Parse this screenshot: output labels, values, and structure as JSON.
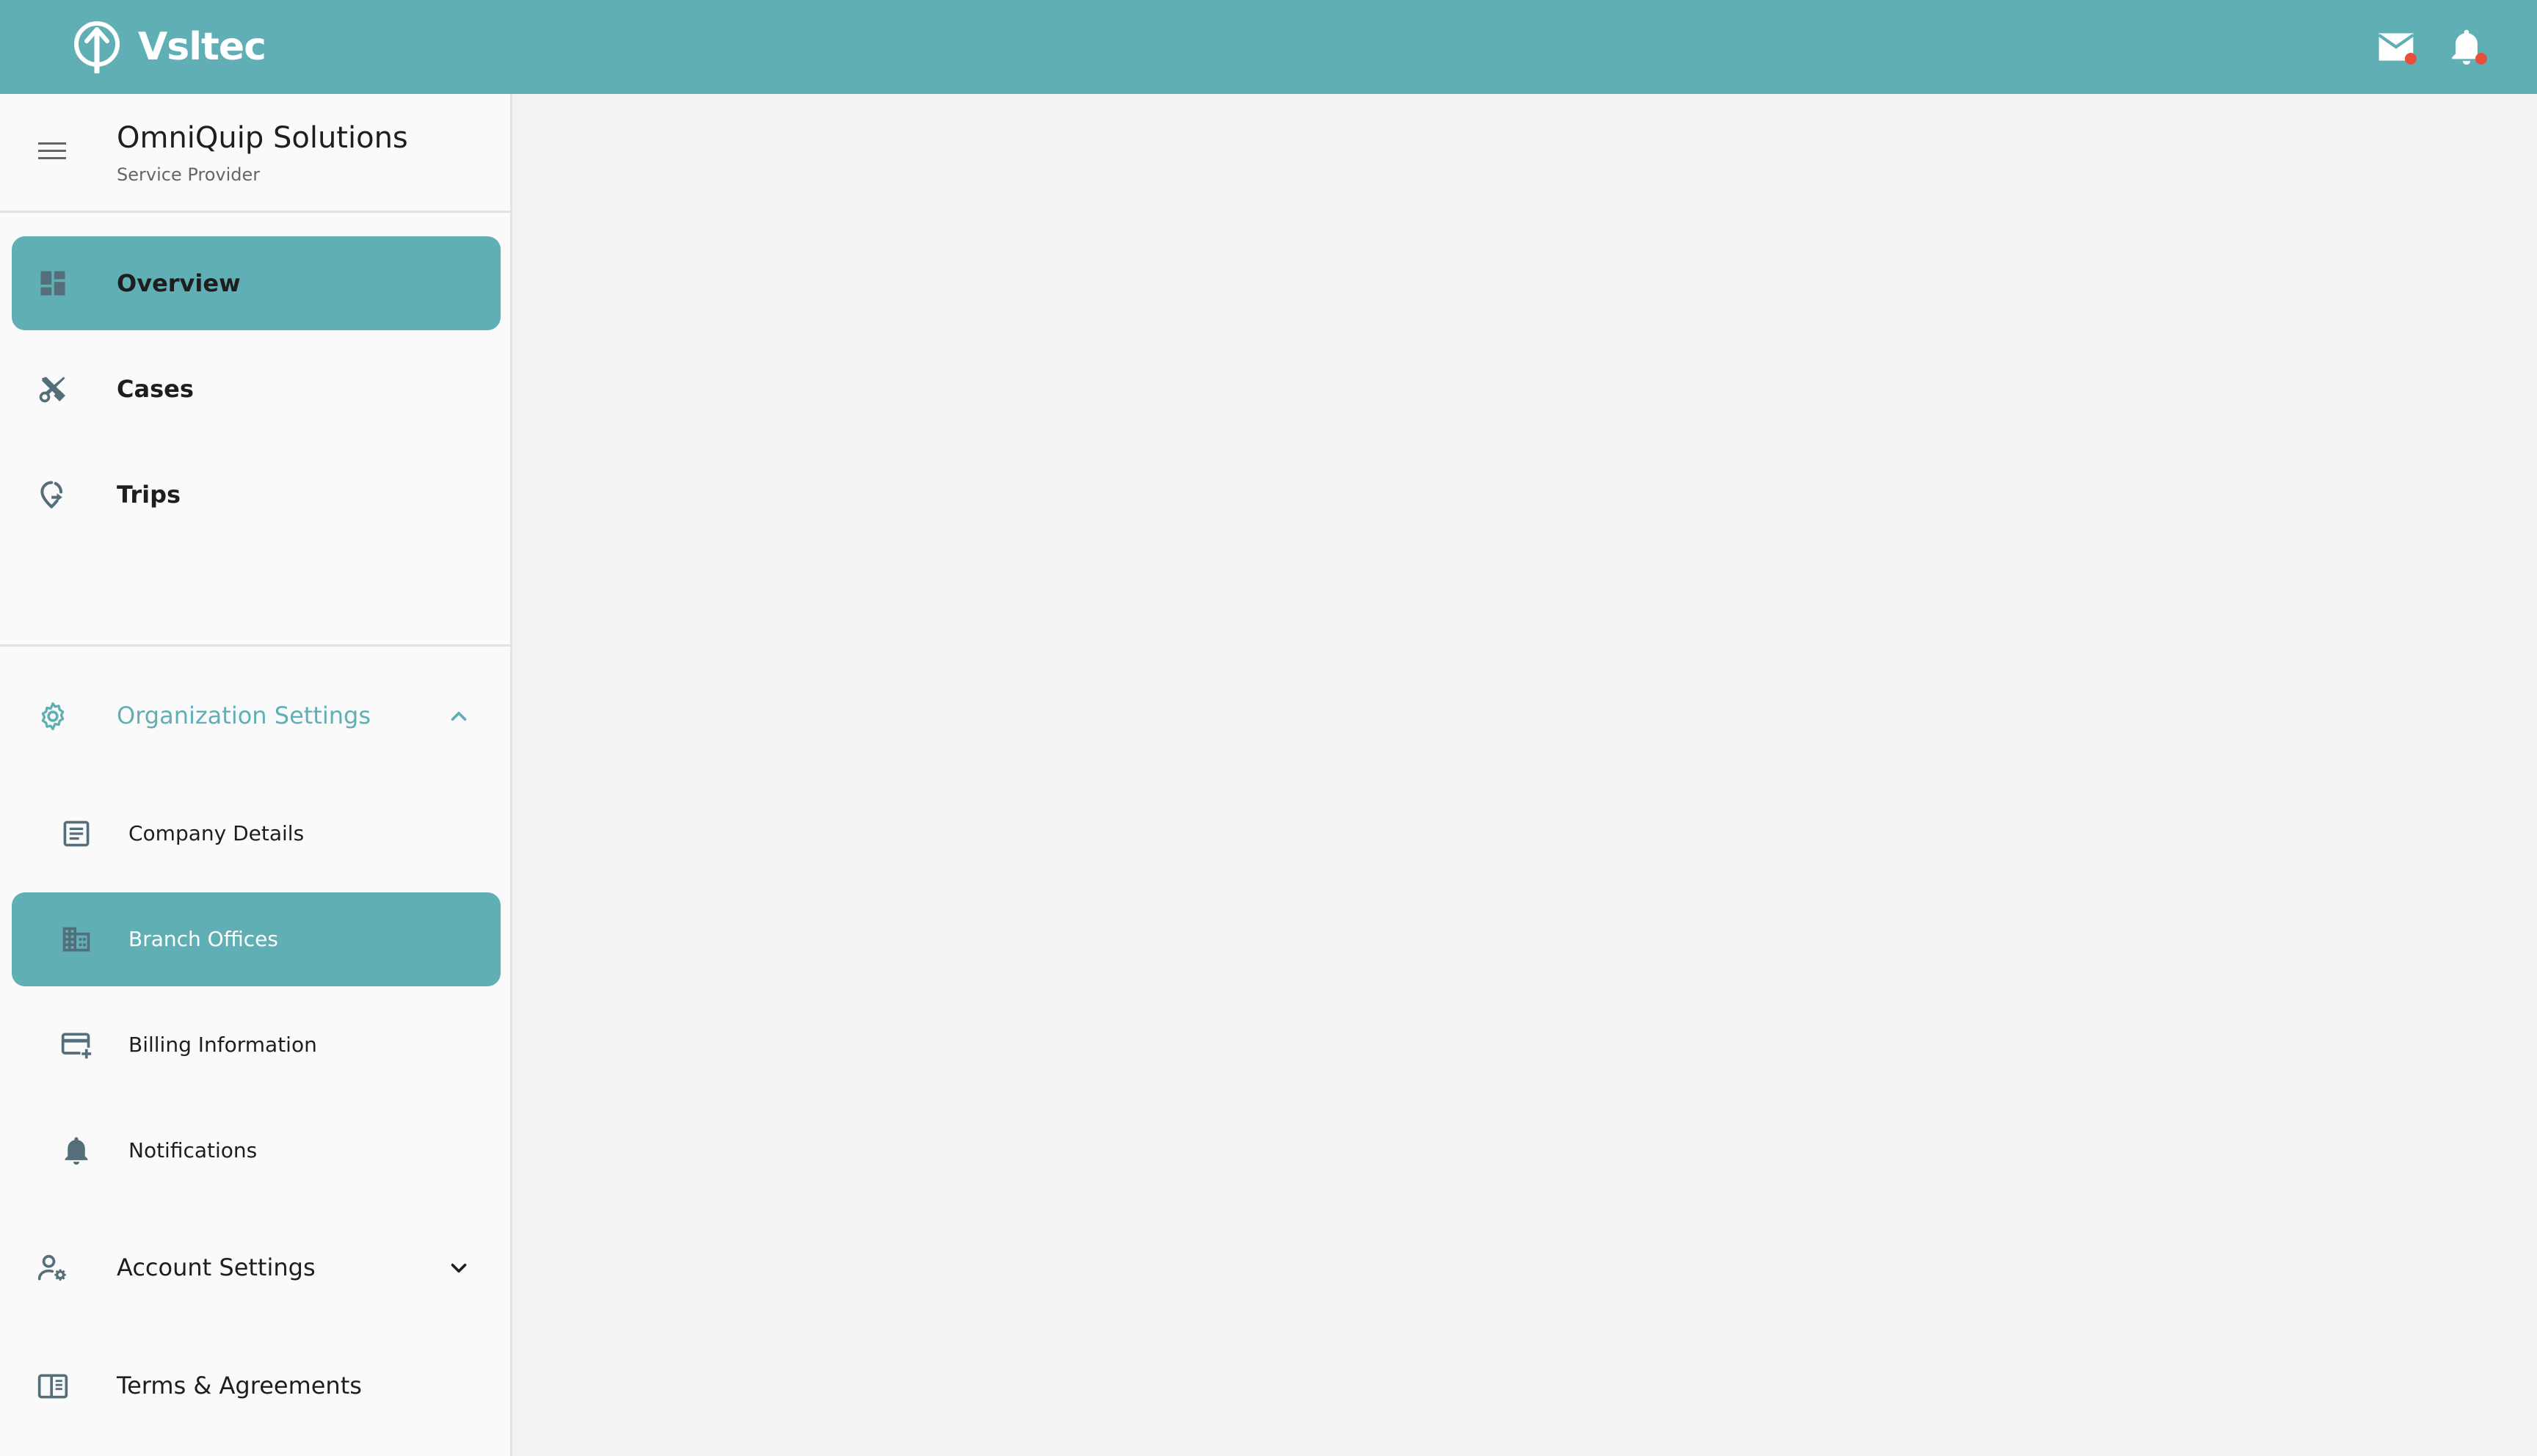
{
  "app": {
    "brand": "Vsltec",
    "accent_color": "#5fafb5"
  },
  "topbar": {
    "mail_icon": "mail-icon",
    "bell_icon": "bell-icon"
  },
  "org": {
    "name": "OmniQuip Solutions",
    "role": "Service Provider"
  },
  "nav": {
    "overview": "Overview",
    "cases": "Cases",
    "trips": "Trips"
  },
  "org_settings": {
    "label": "Organization Settings",
    "expanded": true,
    "items": {
      "company_details": "Company Details",
      "branch_offices": "Branch Offices",
      "billing_information": "Billing Information",
      "notifications": "Notifications"
    },
    "active_item": "Branch Offices"
  },
  "account_settings": {
    "label": "Account Settings",
    "expanded": false
  },
  "terms": {
    "label": "Terms & Agreements"
  }
}
